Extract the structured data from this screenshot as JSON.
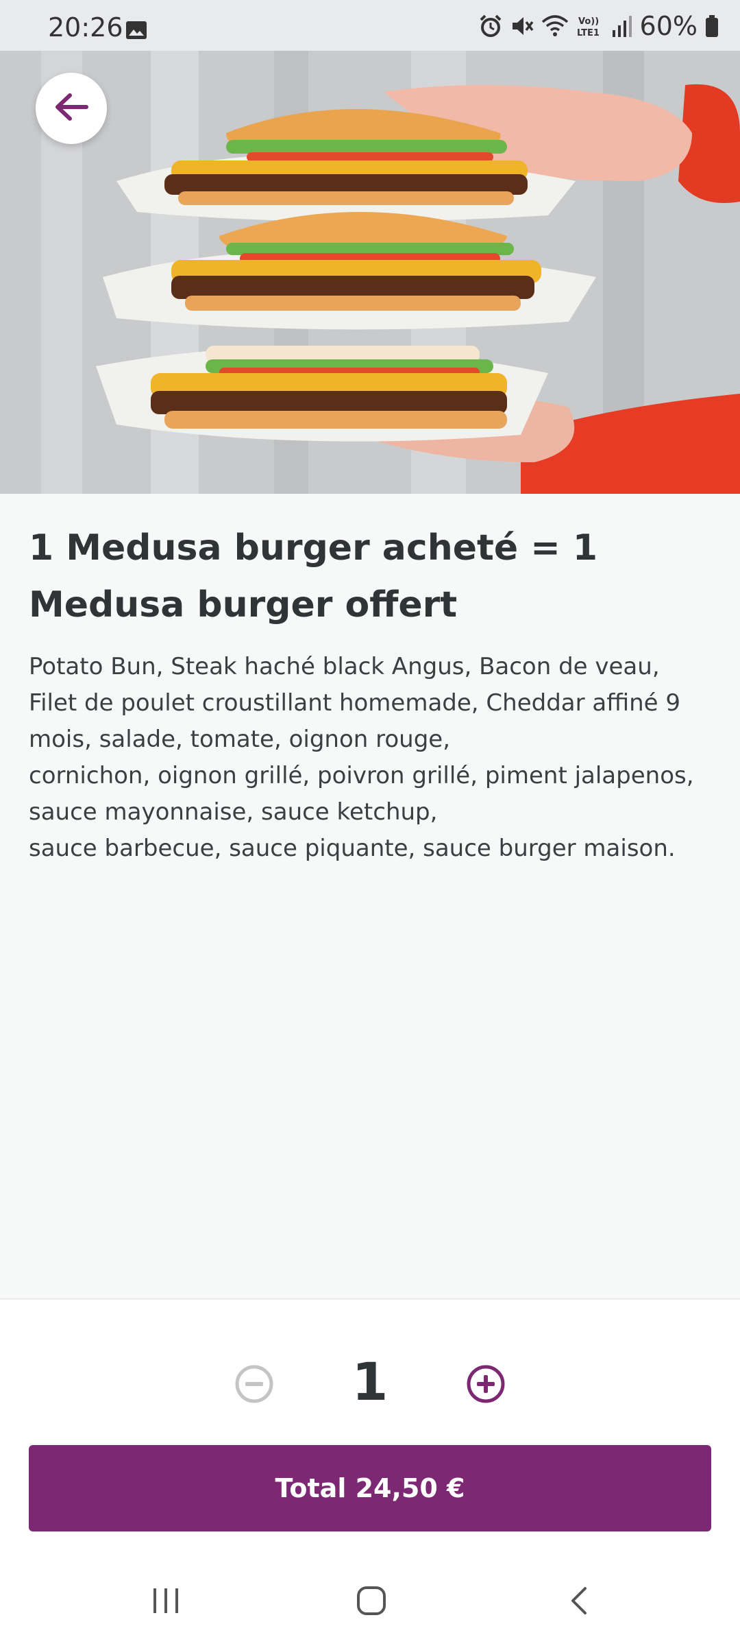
{
  "status_bar": {
    "time": "20:26",
    "battery": "60%",
    "icons": [
      "image-icon",
      "alarm-icon",
      "mute-icon",
      "wifi-icon",
      "volte-icon",
      "signal-icon",
      "battery-icon"
    ]
  },
  "product": {
    "title": "1 Medusa burger acheté = 1 Medusa burger offert",
    "description": "Potato Bun, Steak haché black Angus, Bacon de veau,\nFilet de poulet croustillant homemade, Cheddar affiné 9 mois, salade, tomate, oignon rouge,\ncornichon, oignon grillé, poivron grillé, piment jalapenos, sauce mayonnaise, sauce ketchup,\nsauce barbecue, sauce piquante, sauce burger maison."
  },
  "quantity": {
    "value": "1"
  },
  "cta": {
    "total_label": "Total 24,50 €"
  },
  "colors": {
    "accent": "#7c2872",
    "text": "#2f3436",
    "background": "#f7f8f8",
    "disabled": "#bdbdbd"
  },
  "nav": {
    "icons": [
      "recent-apps-icon",
      "home-icon",
      "back-icon"
    ]
  }
}
